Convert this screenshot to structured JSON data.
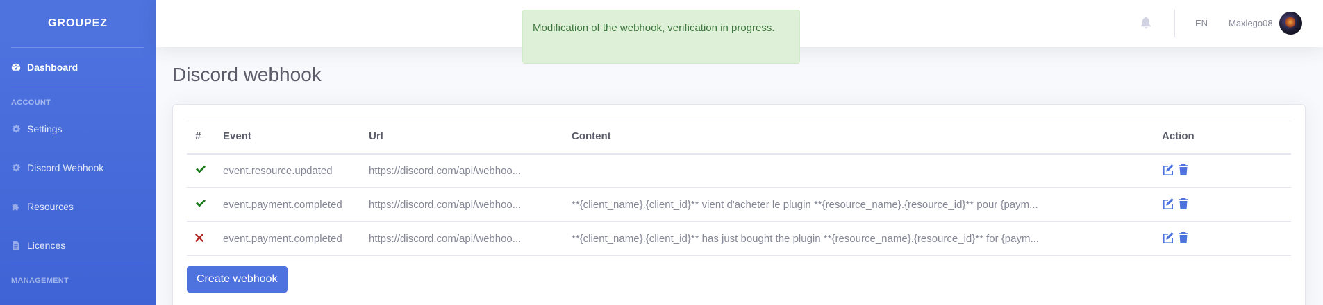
{
  "brand": "GROUPEZ",
  "sidebar": {
    "dashboard": "Dashboard",
    "account_heading": "ACCOUNT",
    "items": [
      {
        "label": "Settings",
        "icon": "gear-icon"
      },
      {
        "label": "Discord Webhook",
        "icon": "gear-icon"
      },
      {
        "label": "Resources",
        "icon": "puzzle-icon"
      },
      {
        "label": "Licences",
        "icon": "file-icon"
      }
    ],
    "management_heading": "MANAGEMENT"
  },
  "topbar": {
    "language": "EN",
    "username": "Maxlego08"
  },
  "alert": {
    "message": "Modification of the webhook, verification in progress."
  },
  "page": {
    "title": "Discord webhook"
  },
  "table": {
    "headers": [
      "#",
      "Event",
      "Url",
      "Content",
      "Action"
    ],
    "rows": [
      {
        "status": "enabled",
        "event": "event.resource.updated",
        "url": "https://discord.com/api/webhoo...",
        "content": ""
      },
      {
        "status": "enabled",
        "event": "event.payment.completed",
        "url": "https://discord.com/api/webhoo...",
        "content": "**{client_name}.{client_id}** vient d'acheter le plugin **{resource_name}.{resource_id}** pour {paym..."
      },
      {
        "status": "disabled",
        "event": "event.payment.completed",
        "url": "https://discord.com/api/webhoo...",
        "content": "**{client_name}.{client_id}** has just bought the plugin **{resource_name}.{resource_id}** for {paym..."
      }
    ]
  },
  "buttons": {
    "create": "Create webhook"
  },
  "colors": {
    "primary": "#4e73df",
    "success_check": "#1b7a1b",
    "danger_cross": "#b31d1d",
    "alert_bg": "#dff0d8"
  }
}
